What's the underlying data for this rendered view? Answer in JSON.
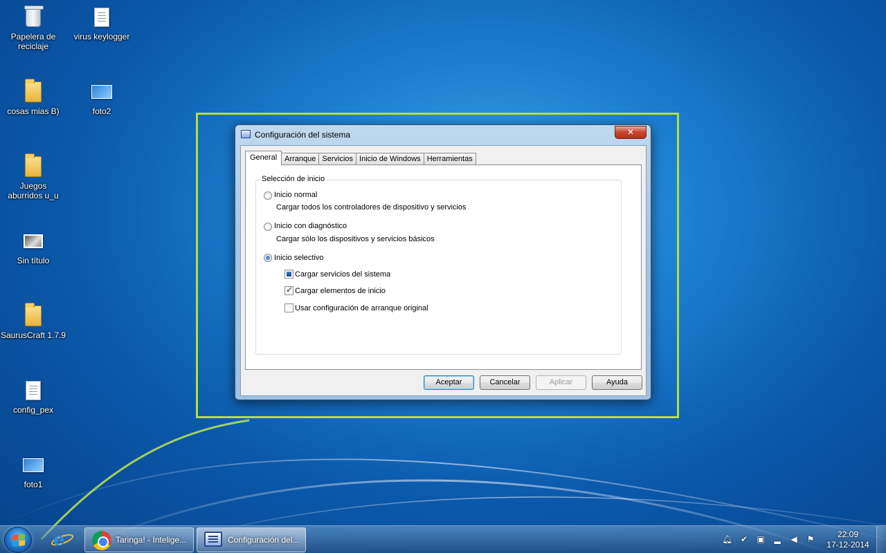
{
  "desktop": {
    "icons": [
      {
        "label": "Papelera de reciclaje",
        "icon": "recycle-bin-icon"
      },
      {
        "label": "virus keylogger",
        "icon": "text-file-icon"
      },
      {
        "label": "cosas mias B)",
        "icon": "folder-icon"
      },
      {
        "label": "foto2",
        "icon": "image-file-icon"
      },
      {
        "label": "Juegos aburridos u_u",
        "icon": "folder-icon"
      },
      {
        "label": "Sin título",
        "icon": "image-file-icon"
      },
      {
        "label": "SaurusCraft 1.7.9",
        "icon": "folder-icon"
      },
      {
        "label": "config_pex",
        "icon": "text-file-icon"
      },
      {
        "label": "foto1",
        "icon": "image-file-icon"
      }
    ]
  },
  "dialog": {
    "title": "Configuración del sistema",
    "close_glyph": "✕",
    "tabs": [
      "General",
      "Arranque",
      "Servicios",
      "Inicio de Windows",
      "Herramientas"
    ],
    "active_tab": "General",
    "group_label": "Selección de inicio",
    "options": {
      "normal": {
        "label": "Inicio normal",
        "desc": "Cargar todos los controladores de dispositivo y servicios",
        "selected": false
      },
      "diagnostic": {
        "label": "Inicio con diagnóstico",
        "desc": "Cargar sólo los dispositivos y servicios básicos",
        "selected": false
      },
      "selective": {
        "label": "Inicio selectivo",
        "selected": true
      }
    },
    "checkboxes": [
      {
        "label": "Cargar servicios del sistema",
        "state": "indeterminate"
      },
      {
        "label": "Cargar elementos de inicio",
        "state": "checked"
      },
      {
        "label": "Usar configuración de arranque original",
        "state": "unchecked"
      }
    ],
    "buttons": {
      "ok": "Aceptar",
      "cancel": "Cancelar",
      "apply": "Aplicar",
      "help": "Ayuda"
    }
  },
  "highlight_color": "#b4e03a",
  "taskbar": {
    "items": [
      {
        "label": "Taringa! - Intelige...",
        "icon": "chrome-icon"
      },
      {
        "label": "Configuración del...",
        "icon": "system-config-icon",
        "active": true
      }
    ],
    "tray": [
      "notification-bell-icon",
      "action-center-icon",
      "network-adapter-icon",
      "signal-icon",
      "volume-icon",
      "flag-icon"
    ],
    "clock": {
      "time": "22:09",
      "date": "17-12-2014"
    }
  }
}
